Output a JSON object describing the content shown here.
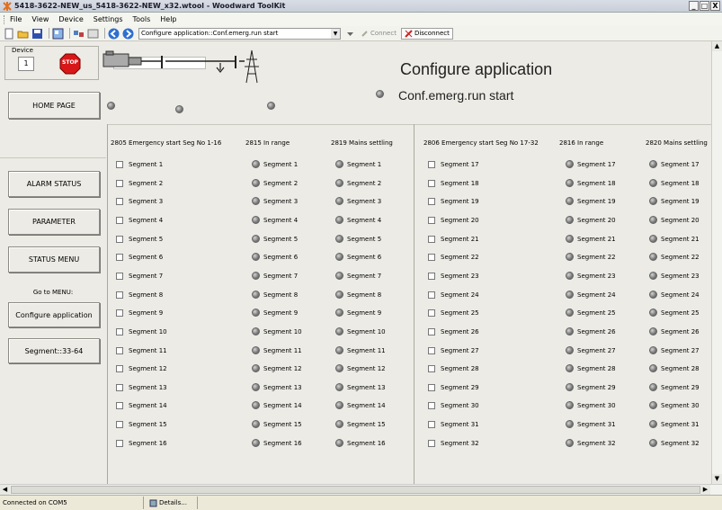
{
  "window": {
    "title": "5418-3622-NEW_us_5418-3622-NEW_x32.wtool - Woodward ToolKit",
    "min": "_",
    "max": "□",
    "close": "X"
  },
  "menu": [
    "File",
    "View",
    "Device",
    "Settings",
    "Tools",
    "Help"
  ],
  "toolbar": {
    "combo_value": "Configure application::Conf.emerg.run start",
    "connect_label": "Connect",
    "disconnect_label": "Disconnect"
  },
  "device": {
    "label": "Device",
    "number": "1",
    "stop_text": "STOP"
  },
  "nav": {
    "home": "HOME PAGE",
    "alarm": "ALARM STATUS",
    "parameter": "PARAMETER",
    "status": "STATUS MENU",
    "goto": "Go to MENU:",
    "configure": "Configure application",
    "segments": "Segment::33-64"
  },
  "page": {
    "title": "Configure application",
    "subtitle": "Conf.emerg.run start"
  },
  "columns": {
    "left_checkbox": "2805 Emergency start Seg No 1-16",
    "left_inrange": "2815 In range",
    "left_mains": "2819 Mains settling",
    "right_checkbox": "2806 Emergency start Seg No 17-32",
    "right_inrange": "2816 In range",
    "right_mains": "2820 Mains settling"
  },
  "segments_left": [
    "Segment 1",
    "Segment 2",
    "Segment 3",
    "Segment 4",
    "Segment 5",
    "Segment 6",
    "Segment 7",
    "Segment 8",
    "Segment 9",
    "Segment 10",
    "Segment 11",
    "Segment 12",
    "Segment 13",
    "Segment 14",
    "Segment 15",
    "Segment 16"
  ],
  "segments_right": [
    "Segment 17",
    "Segment 18",
    "Segment 19",
    "Segment 20",
    "Segment 21",
    "Segment 22",
    "Segment 23",
    "Segment 24",
    "Segment 25",
    "Segment 26",
    "Segment 27",
    "Segment 28",
    "Segment 29",
    "Segment 30",
    "Segment 31",
    "Segment 32"
  ],
  "status": {
    "connection": "Connected on COM5",
    "details": "Details..."
  },
  "icons": [
    "app-icon",
    "new-icon",
    "open-icon",
    "save-icon",
    "network-icon",
    "back-icon",
    "forward-icon",
    "stop-icon",
    "generator-icon",
    "pylon-icon",
    "breaker-icon"
  ]
}
